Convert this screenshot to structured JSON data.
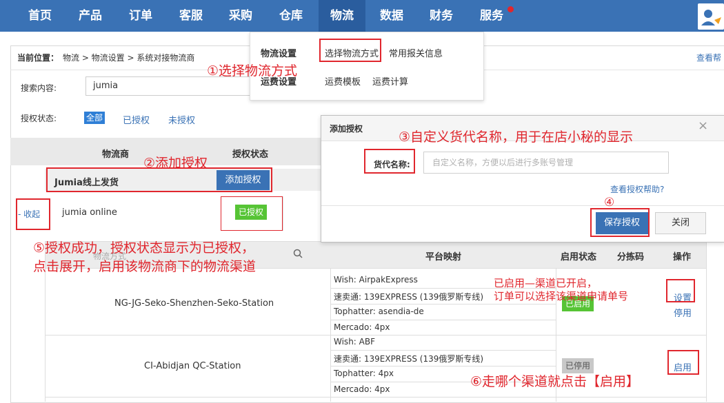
{
  "nav": {
    "items": [
      "首页",
      "产品",
      "订单",
      "客服",
      "采购",
      "仓库",
      "物流",
      "数据",
      "财务",
      "服务"
    ],
    "active": "物流"
  },
  "dropdown": {
    "group1_label": "物流设置",
    "group1_link1": "选择物流方式",
    "group1_link2": "常用报关信息",
    "group2_label": "运费设置",
    "group2_link1": "运费模板",
    "group2_link2": "运费计算"
  },
  "breadcrumb": {
    "label": "当前位置：",
    "path": "物流 > 物流设置 > 系统对接物流商",
    "help": "查看帮"
  },
  "search": {
    "label": "搜索内容:",
    "value": "jumia"
  },
  "filter": {
    "label": "授权状态:",
    "options": [
      "全部",
      "已授权",
      "未授权"
    ]
  },
  "table": {
    "col_carrier": "物流商",
    "col_status": "授权状态",
    "group_title": "Jumia线上发货",
    "add_auth_button": "添加授权",
    "collapse_link": "- 收起",
    "carrier_name": "jumia online",
    "auth_status": "已授权"
  },
  "modal": {
    "title": "添加授权",
    "close_icon": "×",
    "field_label": "货代名称:",
    "field_placeholder": "自定义名称，方便以后进行多账号管理",
    "help_link": "查看授权帮助?",
    "save_button": "保存授权",
    "close_button": "关闭"
  },
  "channel_table": {
    "search_placeholder": "物流方式",
    "col_mapping": "平台映射",
    "col_status": "启用状态",
    "col_sort_code": "分拣码",
    "col_action": "操作",
    "rows": [
      {
        "name": "NG-JG-Seko-Shenzhen-Seko-Station",
        "mappings": [
          "Wish:  AirpakExpress",
          "速卖通:  139EXPRESS (139俄罗斯专线)",
          "Tophatter:  asendia-de",
          "Mercado:  4px"
        ],
        "status": "已启用",
        "actions": [
          "设置",
          "停用"
        ]
      },
      {
        "name": "CI-Abidjan QC-Station",
        "mappings": [
          "Wish:  ABF",
          "速卖通:  139EXPRESS (139俄罗斯专线)",
          "Tophatter:  4px",
          "Mercado:  4px"
        ],
        "status": "已停用",
        "actions": [
          "启用"
        ]
      }
    ]
  },
  "annotations": {
    "a1": "①选择物流方式",
    "a2": "②添加授权",
    "a3": "③自定义货代名称，用于在店小秘的显示",
    "a4": "④",
    "a5_line1": "⑤授权成功，授权状态显示为已授权，",
    "a5_line2": "点击展开，启用该物流商下的物流渠道",
    "a6": "⑥走哪个渠道就点击【启用】",
    "note_line1": "已启用—渠道已开启，",
    "note_line2": "订单可以选择该渠道申请单号"
  },
  "colors": {
    "nav": "#3a72b5",
    "accent": "#2f7fd6",
    "annotation": "#e0262d",
    "enabled": "#56c435",
    "disabled": "#c8c8c8"
  }
}
